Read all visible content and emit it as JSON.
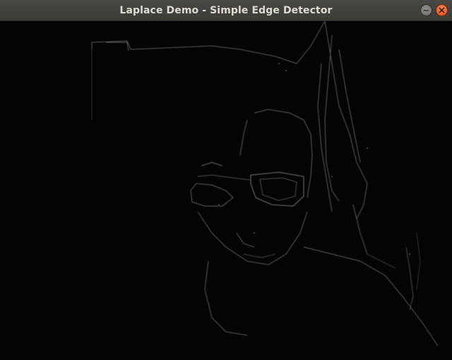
{
  "window": {
    "title": "Laplace Demo - Simple Edge Detector"
  },
  "controls": {
    "minimize_icon": "minimize-icon",
    "close_icon": "close-icon",
    "close_color": "#e9541e"
  },
  "image": {
    "content": "laplacian edge map of a person wearing glasses in front of a wall, with a draped cloth on the right"
  }
}
